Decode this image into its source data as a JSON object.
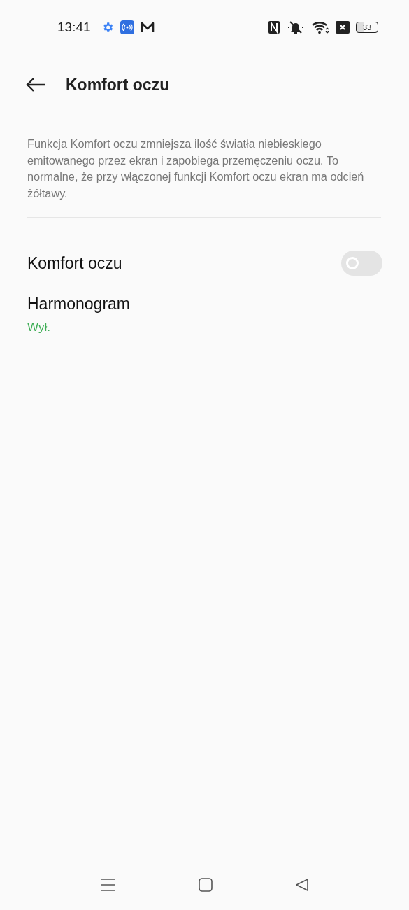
{
  "status_bar": {
    "time": "13:41",
    "battery": "33"
  },
  "header": {
    "title": "Komfort oczu"
  },
  "description": "Funkcja Komfort oczu zmniejsza ilość światła niebieskiego emitowanego przez ekran i zapobiega przemęczeniu oczu. To normalne, że przy włączonej funkcji Komfort oczu ekran ma odcień żółtawy.",
  "settings": [
    {
      "kind": "toggle",
      "label": "Komfort oczu",
      "on": false
    },
    {
      "kind": "link",
      "label": "Harmonogram",
      "value": "Wył."
    }
  ]
}
